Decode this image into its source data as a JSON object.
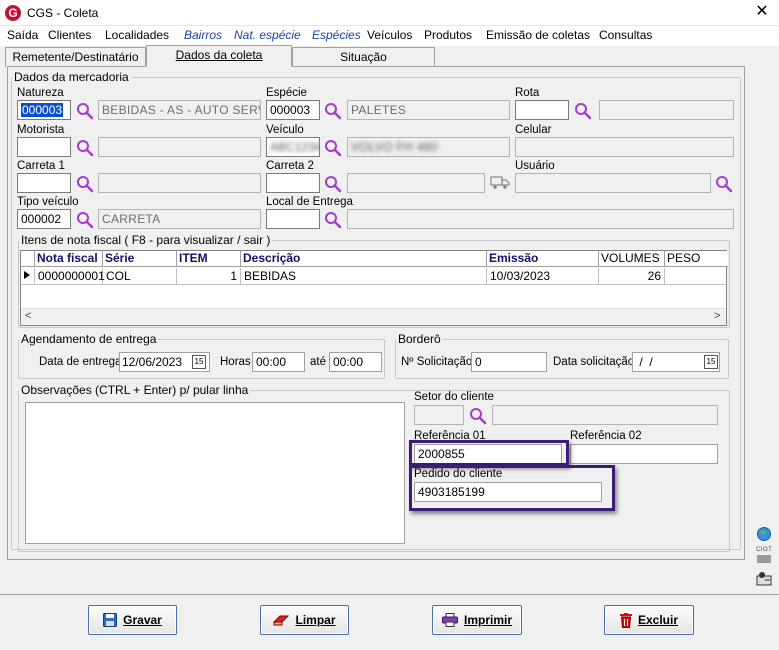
{
  "window": {
    "title": "CGS - Coleta",
    "logo_letter": "G",
    "close_symbol": "✕"
  },
  "menu": [
    "Saída",
    "Clientes",
    "Localidades",
    "Bairros",
    "Nat. espécie",
    "Espécies",
    "Veículos",
    "Produtos",
    "Emissão de coletas",
    "Consultas"
  ],
  "tabs": [
    "Remetente/Destinatário",
    "Dados da coleta",
    "Situação"
  ],
  "mercadoria": {
    "legend": "Dados da mercadoria",
    "natureza": {
      "label": "Natureza",
      "code": "000003",
      "desc": "BEBIDAS - AS - AUTO SERVICO"
    },
    "especie": {
      "label": "Espécie",
      "code": "000003",
      "desc": "PALETES"
    },
    "rota": {
      "label": "Rota",
      "code": "",
      "desc": ""
    },
    "motorista": {
      "label": "Motorista",
      "code": "",
      "desc": ""
    },
    "veiculo": {
      "label": "Veículo",
      "code": "ABC1234",
      "desc": "VOLVO FH 460"
    },
    "celular": {
      "label": "Celular",
      "value": ""
    },
    "carreta1": {
      "label": "Carreta 1",
      "code": "",
      "desc": ""
    },
    "carreta2": {
      "label": "Carreta 2",
      "code": "",
      "desc": ""
    },
    "usuario": {
      "label": "Usuário",
      "value": ""
    },
    "tipo_veiculo": {
      "label": "Tipo veículo",
      "code": "000002",
      "desc": "CARRETA"
    },
    "local_entrega": {
      "label": "Local de Entrega",
      "code": "",
      "desc": ""
    }
  },
  "itens": {
    "legend": "Itens de nota fiscal ( F8 - para visualizar / sair )",
    "columns": [
      "Nota fiscal",
      "Série",
      "ITEM",
      "Descrição",
      "Emissão",
      "VOLUMES",
      "PESO"
    ],
    "rows": [
      [
        "0000000001",
        "COL",
        "1",
        "BEBIDAS",
        "10/03/2023",
        "26",
        ""
      ]
    ],
    "scroll_left": "<",
    "scroll_right": ">"
  },
  "agendamento": {
    "legend": "Agendamento de entrega",
    "data_label": "Data de entrega",
    "data": "12/06/2023",
    "horas_label": "Horas",
    "hora_ini": "00:00",
    "ate_label": "até",
    "hora_fim": "00:00",
    "cal_icon": "15"
  },
  "bordero": {
    "legend": "Borderô",
    "solic_label": "Nº Solicitação",
    "solic": "0",
    "data_label": "Data solicitação",
    "data": " /  /",
    "cal_icon": "15"
  },
  "observacoes": {
    "legend": "Observações (CTRL + Enter) p/ pular linha",
    "text": ""
  },
  "setor": {
    "label": "Setor do cliente",
    "code": "",
    "desc": ""
  },
  "referencia01": {
    "label": "Referência 01",
    "value": "2000855"
  },
  "referencia02": {
    "label": "Referência 02",
    "value": ""
  },
  "pedido": {
    "label": "Pedido do cliente",
    "value": "4903185199"
  },
  "side_label": "CIOT",
  "buttons": {
    "gravar": "Gravar",
    "limpar": "Limpar",
    "imprimir": "Imprimir",
    "excluir": "Excluir"
  },
  "colors": {
    "accent": "#0b4fd1",
    "highlight": "#3b1c78",
    "menu_blue": "#1a3fb0",
    "magnifier": "#a33fc9"
  }
}
